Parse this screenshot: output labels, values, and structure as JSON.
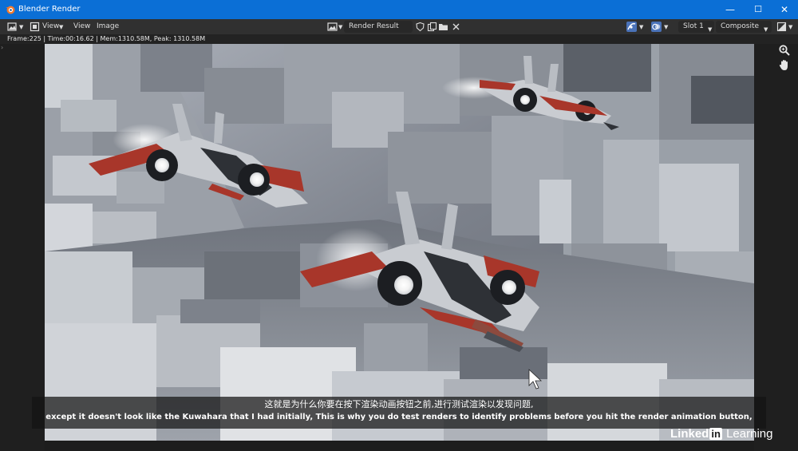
{
  "window": {
    "title": "Blender Render",
    "minimize": "—",
    "maximize": "☐",
    "close": "✕"
  },
  "toolbar": {
    "menu_view": "View",
    "menu_image": "Image",
    "image_name": "Render Result",
    "slot": "Slot 1",
    "layer": "Composite"
  },
  "info": {
    "stats": "Frame:225 | Time:00:16.62 | Mem:1310.58M, Peak: 1310.58M"
  },
  "subtitles": {
    "line_zh": "这就是为什么你要在按下渲染动画按钮之前,进行测试渲染以发现问题,",
    "line_en": "except it doesn't look like the Kuwahara that I had initially, This is why you do test renders to identify problems before you hit the render animation button,"
  },
  "watermark": {
    "part1": "Linked",
    "part2": "in",
    "part3": " Learning"
  },
  "colors": {
    "titlebar": "#0b6fd6",
    "toolbar": "#303030",
    "hull_red": "#a8362a",
    "hull_grey": "#c9ccd1"
  },
  "icons": {
    "app": "blender-logo-icon",
    "zoom": "magnifier-icon",
    "pan": "hand-icon"
  }
}
